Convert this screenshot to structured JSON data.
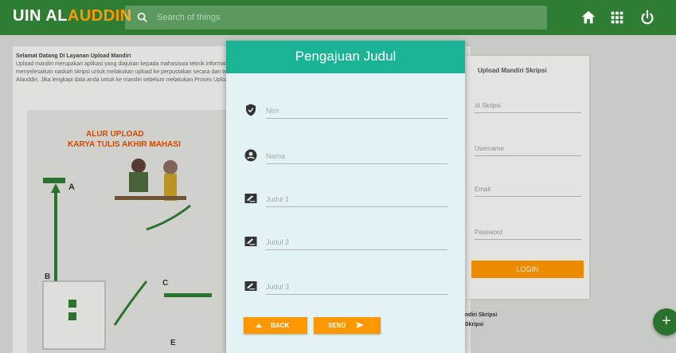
{
  "brand": {
    "part1": "UIN AL",
    "part2": "AUDDIN"
  },
  "search": {
    "placeholder": "Search of things"
  },
  "welcome": {
    "title": "Selamat Datang Di Layanan Upload Mandiri",
    "body": "Upload mandiri merupakan aplikasi yang diajukan kepada mahasiswa teknik informatika yang telah menyelesaikan naskah skripsi untuk melakukan upload ke perpustakan secara dan terjadikan UIN Alauddin. Jika lengkapi data anda untuk ke mandiri sebelum melakukan Proses Upload Tugas Akhir"
  },
  "flow": {
    "title": "ALUR UPLOAD",
    "subtitle": "KARYA TULIS AKHIR MAHASI"
  },
  "right_card": {
    "title": "Upload Mandiri Skripsi",
    "fields": [
      "Id Skripsi",
      "Username",
      "Email",
      "Password"
    ],
    "login_label": "LOGIN"
  },
  "bottom": {
    "line1": "andiri Skripsi",
    "line2": "i Skripsi"
  },
  "modal": {
    "title": "Pengajuan Judul",
    "fields": [
      {
        "placeholder": "Nim",
        "icon": "shield-icon"
      },
      {
        "placeholder": "Nama",
        "icon": "user-icon"
      },
      {
        "placeholder": "Judul 1",
        "icon": "edit-icon"
      },
      {
        "placeholder": "Judul 2",
        "icon": "edit-icon"
      },
      {
        "placeholder": "Judul 3",
        "icon": "edit-icon"
      }
    ],
    "back_label": "BACK",
    "send_label": "SEND"
  },
  "colors": {
    "topbar": "#2e7d32",
    "modal_header": "#1ab394",
    "accent": "#ff9800",
    "modal_body": "#e3f3f5"
  }
}
